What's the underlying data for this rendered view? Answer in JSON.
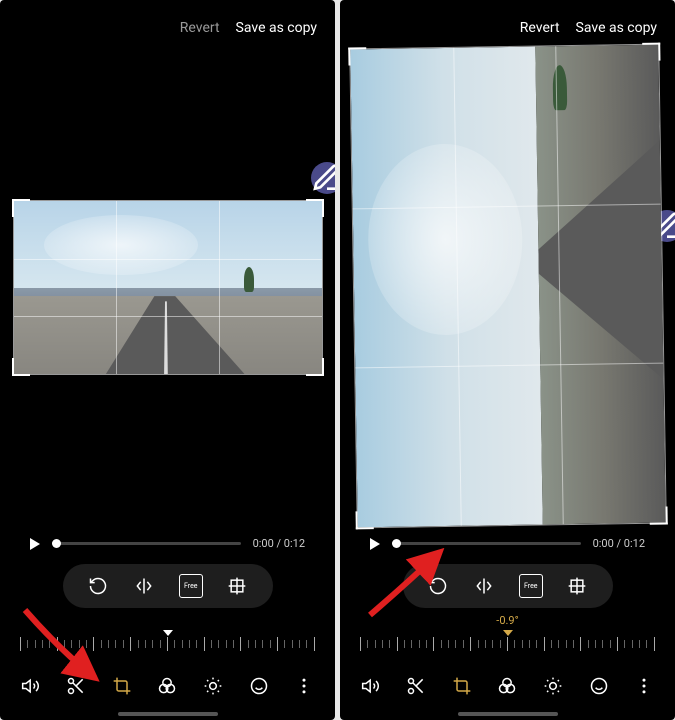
{
  "left": {
    "header": {
      "revert": "Revert",
      "save_as_copy": "Save as copy"
    },
    "playback": {
      "timecode": "0:00 / 0:12"
    },
    "angle_label": ""
  },
  "right": {
    "header": {
      "revert": "Revert",
      "save_as_copy": "Save as copy"
    },
    "playback": {
      "timecode": "0:00 / 0:12"
    },
    "crop_tools": {
      "aspect_label": "Free"
    },
    "angle_label": "-0.9°"
  },
  "shared": {
    "crop_tools": {
      "aspect_label": "Free"
    }
  }
}
